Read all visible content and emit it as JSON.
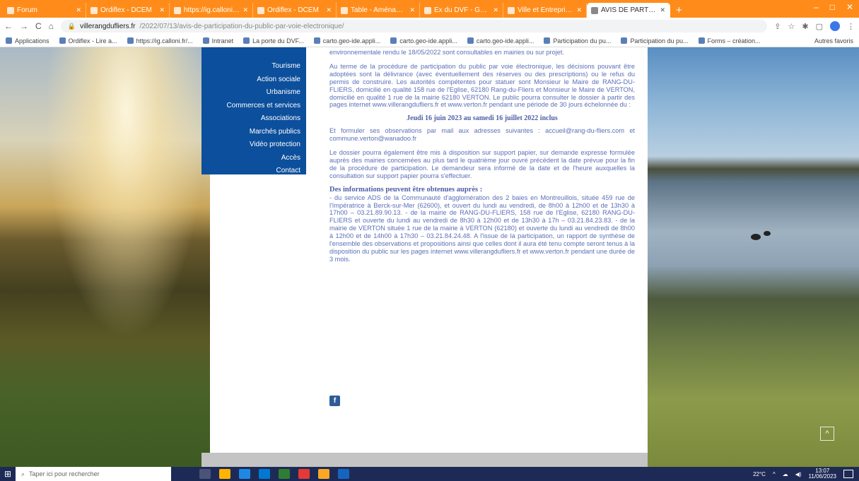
{
  "browser": {
    "tabs": [
      {
        "title": "Forum",
        "active": false
      },
      {
        "title": "Ordiflex - DCEM",
        "active": false
      },
      {
        "title": "https://ig.calloni.fr/...",
        "active": false
      },
      {
        "title": "Ordiflex - DCEM",
        "active": false
      },
      {
        "title": "Table - Aménagement",
        "active": false
      },
      {
        "title": "Ex du DVF - Google Maps",
        "active": false
      },
      {
        "title": "Ville et Entreprises - Vous",
        "active": false
      },
      {
        "title": "AVIS DE PARTICIPATION",
        "active": true
      }
    ],
    "new_tab": "+",
    "window_controls": [
      "–",
      "□",
      "✕"
    ],
    "nav": {
      "back": "←",
      "forward": "→",
      "reload": "C",
      "home": "⌂"
    },
    "url_host": "villerangdufliers.fr",
    "url_path": "/2022/07/13/avis-de-participation-du-public-par-voie-electronique/",
    "lock_icon": "🔒",
    "bookmarks": [
      "Applications",
      "Ordiflex - Lire a...",
      "https://ig.calloni.fr/...",
      "Intranet",
      "La porte du DVF...",
      "carto.geo-ide.appli...",
      "carto.geo-ide.appli...",
      "carto.geo-ide.appli...",
      "Participation du pu...",
      "Participation du pu...",
      "Forms – création..."
    ],
    "other_bookmarks": "Autres favoris"
  },
  "menu": {
    "items": [
      "Tourisme",
      "Action sociale",
      "Urbanisme",
      "Commerces et services",
      "Associations",
      "Marchés publics",
      "Vidéo protection",
      "Accès",
      "Contact"
    ]
  },
  "article": {
    "p0": "environnementale rendu le 18/05/2022 sont consultables en mairies ou sur projet.",
    "p1": "Au terme de la procédure de participation du public par voie électronique, les décisions pouvant être adoptées sont la délivrance (avec éventuellement des réserves ou des prescriptions) ou le refus du permis de construire. Les autorités compétentes pour statuer sont Monsieur le Maire de RANG-DU-FLIERS, domicilié en qualité 158 rue de l'Eglise, 62180 Rang-du-Fliers et Monsieur le Maire de VERTON, domicilié en qualité 1 rue de la mairie 62180 VERTON. Le public pourra consulter le dossier à partir des pages internet www.villerangdufliers.fr et www.verton.fr pendant une période de 30 jours échelonnée du :",
    "dates": "Jeudi 16 juin 2023 au samedi 16 juillet 2022 inclus",
    "p2": "Et formuler ses observations par mail aux adresses suivantes : accueil@rang-du-fliers.com et commune.verton@wanadoo.fr",
    "p3": "Le dossier pourra également être mis à disposition sur support papier, sur demande expresse formulée auprès des mairies concernées au plus tard le quatrième jour ouvré précédent la date prévue pour la fin de la procédure de participation. Le demandeur sera informé de la date et de l'heure auxquelles la consultation sur support papier pourra s'effectuer.",
    "subhead": "Des informations peuvent être obtenues auprès :",
    "p4": "- du service ADS de la Communauté d'agglomération des 2 baies en Montreuillois, située 459 rue de l'Impératrice à Berck-sur-Mer (62600), et ouvert du lundi au vendredi, de 8h00 à 12h00 et de 13h30 à 17h00 – 03.21.89.90.13. - de la mairie de RANG-DU-FLIERS, 158 rue de l'Eglise, 62180 RANG-DU-FLIERS et ouverte du lundi au vendredi de 8h30 à 12h00 et de 13h30 à 17h – 03.21.84.23.83. - de la mairie de VERTON située 1 rue de la mairie à VERTON (62180) et ouverte du lundi au vendredi de 8h00 à 12h00 et de 14h00 à 17h30 – 03.21.84.24.48. A l'issue de la participation, un rapport de synthèse de l'ensemble des observations et propositions ainsi que celles dont il aura été tenu compte seront tenus à la disposition du public sur les pages internet www.villerangdufliers.fr et www.verton.fr pendant une durée de 3 mois.",
    "facebook": "f"
  },
  "to_top": "^",
  "taskbar": {
    "start": "⊞",
    "search_icon": "⌕",
    "search_placeholder": "Taper ici pour rechercher",
    "tray_weather": "22°C",
    "time": "13:07",
    "date": "11/06/2023"
  }
}
